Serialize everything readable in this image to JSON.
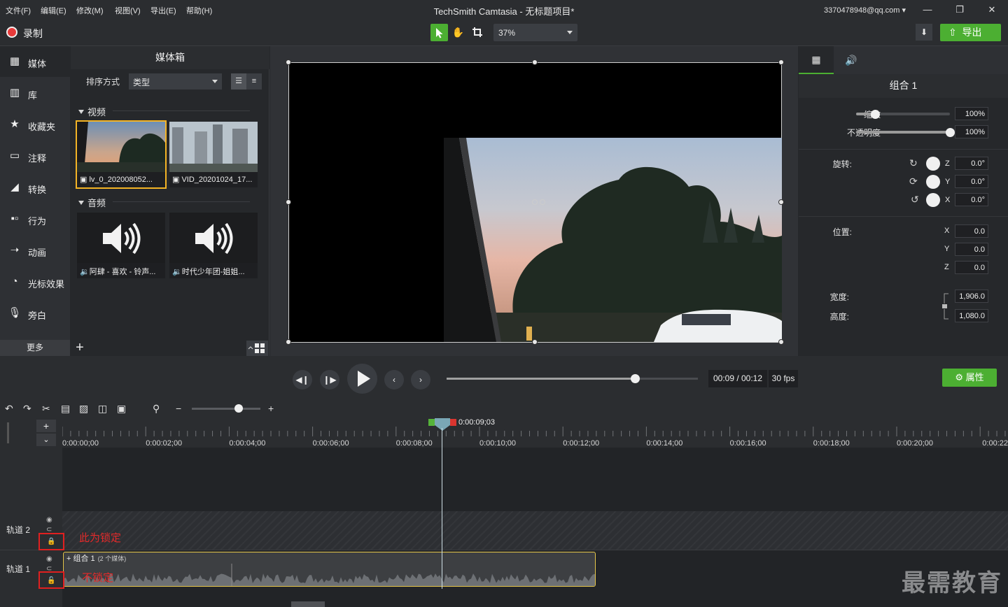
{
  "window": {
    "title": "TechSmith Camtasia - 无标题项目*",
    "account": "3370478948@qq.com",
    "menus": [
      "文件(F)",
      "编辑(E)",
      "修改(M)",
      "视图(V)",
      "导出(E)",
      "帮助(H)"
    ]
  },
  "toolbar": {
    "record_label": "录制",
    "zoom": "37%",
    "export_label": "导出"
  },
  "sidebar": {
    "items": [
      {
        "label": "媒体",
        "icon": "media-icon"
      },
      {
        "label": "库",
        "icon": "library-icon"
      },
      {
        "label": "收藏夹",
        "icon": "star-icon"
      },
      {
        "label": "注释",
        "icon": "annotation-icon"
      },
      {
        "label": "转换",
        "icon": "transition-icon"
      },
      {
        "label": "行为",
        "icon": "behavior-icon"
      },
      {
        "label": "动画",
        "icon": "animation-icon"
      },
      {
        "label": "光标效果",
        "icon": "cursor-icon"
      },
      {
        "label": "旁白",
        "icon": "mic-icon"
      }
    ],
    "more_label": "更多"
  },
  "media_bin": {
    "title": "媒体箱",
    "sort_label": "排序方式",
    "sort_value": "类型",
    "video_section": "视频",
    "audio_section": "音频",
    "videos": [
      "lv_0_202008052...",
      "VID_20201024_17..."
    ],
    "audios": [
      "阿肆 - 喜欢 - 铃声...",
      "时代少年团-姐姐..."
    ]
  },
  "properties": {
    "title": "组合 1",
    "scale_label": "缩放",
    "scale_value": "100%",
    "scale_fraction": 0.2,
    "opacity_label": "不透明度",
    "opacity_value": "100%",
    "opacity_fraction": 1.0,
    "rotation_label": "旋转:",
    "rotation": [
      {
        "axis": "Z",
        "value": "0.0°"
      },
      {
        "axis": "Y",
        "value": "0.0°"
      },
      {
        "axis": "X",
        "value": "0.0°"
      }
    ],
    "position_label": "位置:",
    "position": [
      {
        "axis": "X",
        "value": "0.0"
      },
      {
        "axis": "Y",
        "value": "0.0"
      },
      {
        "axis": "Z",
        "value": "0.0"
      }
    ],
    "width_label": "宽度:",
    "width_value": "1,906.0",
    "height_label": "高度:",
    "height_value": "1,080.0"
  },
  "playback": {
    "timecode": "00:09 / 00:12",
    "fps": "30 fps",
    "progress_fraction": 0.75,
    "properties_label": "属性"
  },
  "timeline": {
    "playhead_time": "0:00:09;03",
    "ticks": [
      "0:00:00;00",
      "0:00:02;00",
      "0:00:04;00",
      "0:00:06;00",
      "0:00:08;00",
      "0:00:10;00",
      "0:00:12;00",
      "0:00:14;00",
      "0:00:16;00",
      "0:00:18;00",
      "0:00:20;00",
      "0:00:22"
    ],
    "tracks": [
      {
        "name": "轨道 2",
        "annotation": "此为锁定"
      },
      {
        "name": "轨道 1",
        "annotation": "不锁定"
      }
    ],
    "clip_title": "组合 1",
    "clip_sub": "(2 个媒体)",
    "watermark": "最需教育"
  },
  "colors": {
    "accent_green": "#4caf32",
    "selection_yellow": "#f3b325",
    "annotation_red": "#e02020"
  }
}
